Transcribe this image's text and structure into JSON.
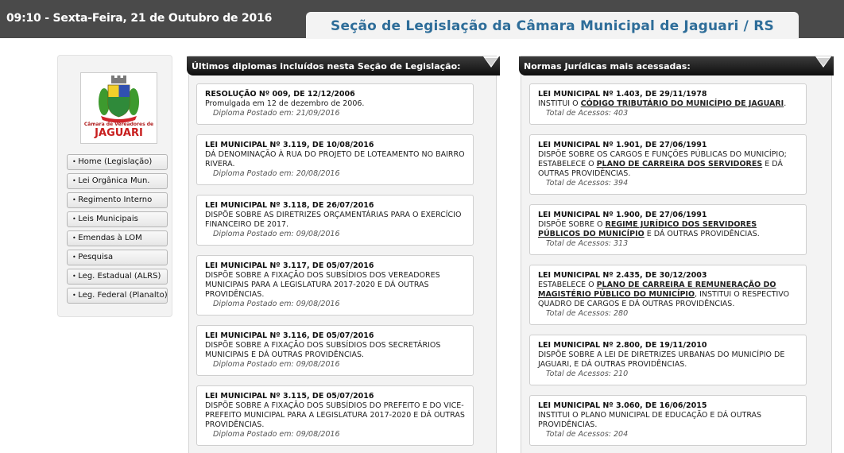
{
  "header": {
    "datetime": "09:10 - Sexta-Feira, 21 de Outubro de 2016",
    "title": "Seção de Legislação da Câmara Municipal de Jaguari / RS"
  },
  "logo": {
    "line1": "Câmara de Vereadores de",
    "line2": "JAGUARI"
  },
  "nav": [
    {
      "label": "Home (Legislação)"
    },
    {
      "label": "Lei Orgânica Mun."
    },
    {
      "label": "Regimento Interno"
    },
    {
      "label": "Leis Municipais"
    },
    {
      "label": "Emendas à LOM"
    },
    {
      "label": "Pesquisa"
    },
    {
      "label": "Leg. Estadual (ALRS)"
    },
    {
      "label": "Leg. Federal (Planalto)"
    }
  ],
  "recent": {
    "heading": "Últimos diplomas incluídos nesta Seção de Legislação:",
    "items": [
      {
        "title": "RESOLUÇÃO Nº 009, DE 12/12/2006",
        "desc": "Promulgada em 12 de dezembro de 2006.",
        "meta": "Diploma Postado em: 21/09/2016"
      },
      {
        "title": "LEI MUNICIPAL Nº 3.119, DE 10/08/2016",
        "desc": "DÁ DENOMINAÇÃO À RUA DO PROJETO DE LOTEAMENTO NO BAIRRO RIVERA.",
        "meta": "Diploma Postado em: 20/08/2016"
      },
      {
        "title": "LEI MUNICIPAL Nº 3.118, DE 26/07/2016",
        "desc": "DISPÕE SOBRE AS DIRETRIZES ORÇAMENTÁRIAS PARA O EXERCÍCIO FINANCEIRO DE 2017.",
        "meta": "Diploma Postado em: 09/08/2016"
      },
      {
        "title": "LEI MUNICIPAL Nº 3.117, DE 05/07/2016",
        "desc": "DISPÕE SOBRE A FIXAÇÃO DOS SUBSÍDIOS DOS VEREADORES MUNICIPAIS PARA A LEGISLATURA 2017-2020 E DÁ OUTRAS PROVIDÊNCIAS.",
        "meta": "Diploma Postado em: 09/08/2016"
      },
      {
        "title": "LEI MUNICIPAL Nº 3.116, DE 05/07/2016",
        "desc": "DISPÕE SOBRE A FIXAÇÃO DOS SUBSÍDIOS DOS SECRETÁRIOS MUNICIPAIS E DÁ OUTRAS PROVIDÊNCIAS.",
        "meta": "Diploma Postado em: 09/08/2016"
      },
      {
        "title": "LEI MUNICIPAL Nº 3.115, DE 05/07/2016",
        "desc": "DISPÕE SOBRE A FIXAÇÃO DOS SUBSÍDIOS DO PREFEITO E DO VICE-PREFEITO MUNICIPAL PARA A LEGISLATURA 2017-2020 E DÁ OUTRAS PROVIDÊNCIAS.",
        "meta": "Diploma Postado em: 09/08/2016"
      }
    ]
  },
  "popular": {
    "heading": "Normas Jurídicas mais acessadas:",
    "items": [
      {
        "title": "LEI MUNICIPAL Nº 1.403, DE 29/11/1978",
        "desc_pre": "INSTITUI O ",
        "desc_link": "CÓDIGO TRIBUTÁRIO DO MUNICÍPIO DE JAGUARI",
        "desc_post": ".",
        "meta": "Total de Acessos: 403"
      },
      {
        "title": "LEI MUNICIPAL Nº 1.901, DE 27/06/1991",
        "desc_pre": "DISPÕE SOBRE OS CARGOS E FUNÇÕES PÚBLICAS DO MUNICÍPIO; ESTABELECE O ",
        "desc_link": "PLANO DE CARREIRA DOS SERVIDORES",
        "desc_post": " E DÁ OUTRAS PROVIDÊNCIAS.",
        "meta": "Total de Acessos: 394"
      },
      {
        "title": "LEI MUNICIPAL Nº 1.900, DE 27/06/1991",
        "desc_pre": "DISPÕE SOBRE O ",
        "desc_link": "REGIME JURÍDICO DOS SERVIDORES PÚBLICOS DO MUNICÍPIO",
        "desc_post": " E DÁ OUTRAS PROVIDÊNCIAS.",
        "meta": "Total de Acessos: 313"
      },
      {
        "title": "LEI MUNICIPAL Nº 2.435, DE 30/12/2003",
        "desc_pre": "ESTABELECE O ",
        "desc_link": "PLANO DE CARREIRA E REMUNERAÇÃO DO MAGISTÉRIO PÚBLICO DO MUNICÍPIO",
        "desc_post": ", INSTITUI O RESPECTIVO QUADRO DE CARGOS E DÁ OUTRAS PROVIDÊNCIAS.",
        "meta": "Total de Acessos: 280"
      },
      {
        "title": "LEI MUNICIPAL Nº 2.800, DE 19/11/2010",
        "desc_pre": "DISPÕE SOBRE A LEI DE DIRETRIZES URBANAS DO MUNICÍPIO DE JAGUARI, E DÁ OUTRAS PROVIDÊNCIAS.",
        "desc_link": "",
        "desc_post": "",
        "meta": "Total de Acessos: 210"
      },
      {
        "title": "LEI MUNICIPAL Nº 3.060, DE 16/06/2015",
        "desc_pre": "INSTITUI O PLANO MUNICIPAL DE EDUCAÇÃO E DÁ OUTRAS PROVIDÊNCIAS.",
        "desc_link": "",
        "desc_post": "",
        "meta": "Total de Acessos: 204"
      }
    ]
  }
}
